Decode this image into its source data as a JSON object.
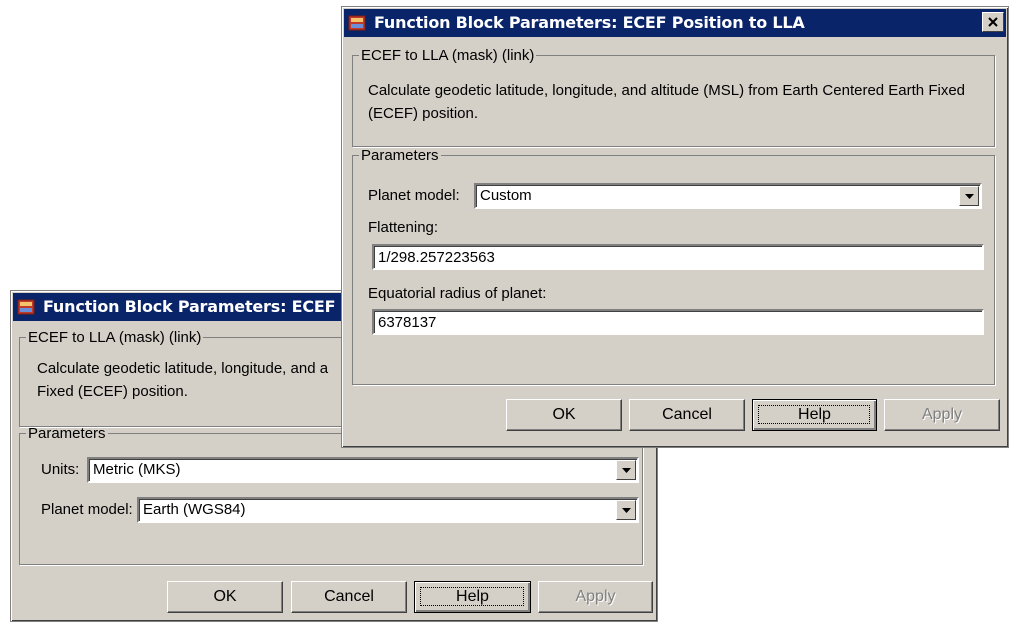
{
  "back_dialog": {
    "title": "Function Block Parameters: ECEF Pos",
    "mask_group_label": "ECEF to LLA (mask) (link)",
    "description": "Calculate geodetic latitude, longitude, and a Fixed (ECEF) position.",
    "params_group_label": "Parameters",
    "units_label": "Units:",
    "units_value": "Metric (MKS)",
    "planet_model_label": "Planet model:",
    "planet_model_value": "Earth (WGS84)",
    "buttons": {
      "ok": "OK",
      "cancel": "Cancel",
      "help": "Help",
      "apply": "Apply"
    }
  },
  "front_dialog": {
    "title": "Function Block Parameters: ECEF Position to LLA",
    "mask_group_label": "ECEF to LLA (mask) (link)",
    "description": "Calculate geodetic latitude, longitude, and altitude (MSL) from Earth Centered Earth Fixed (ECEF) position.",
    "params_group_label": "Parameters",
    "planet_model_label": "Planet model:",
    "planet_model_value": "Custom",
    "flattening_label": "Flattening:",
    "flattening_value": "1/298.257223563",
    "radius_label": "Equatorial radius of planet:",
    "radius_value": "6378137",
    "buttons": {
      "ok": "OK",
      "cancel": "Cancel",
      "help": "Help",
      "apply": "Apply"
    }
  },
  "icons": {
    "app": "simulink-block-icon",
    "close": "close-icon",
    "dropdown": "chevron-down-icon"
  },
  "colors": {
    "titlebar": "#0a246a",
    "dialog_bg": "#d4d0c8"
  }
}
